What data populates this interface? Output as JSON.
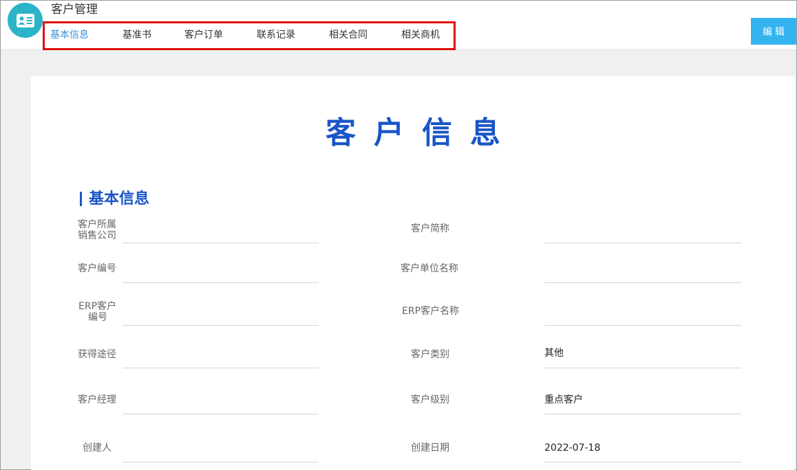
{
  "header": {
    "app_title": "客户管理",
    "logo_icon": "contact-card-icon",
    "tabs": [
      {
        "label": "基本信息",
        "active": true
      },
      {
        "label": "基准书",
        "active": false
      },
      {
        "label": "客户订单",
        "active": false
      },
      {
        "label": "联系记录",
        "active": false
      },
      {
        "label": "相关合同",
        "active": false
      },
      {
        "label": "相关商机",
        "active": false
      }
    ],
    "edit_label": "编辑"
  },
  "document": {
    "title": "客户信息",
    "section_title": "基本信息",
    "fields": {
      "sales_company": {
        "label_line1": "客户所属",
        "label_line2": "销售公司",
        "value": ""
      },
      "short_name": {
        "label": "客户简称",
        "value": ""
      },
      "customer_no": {
        "label": "客户编号",
        "value": ""
      },
      "unit_name": {
        "label": "客户单位名称",
        "value": ""
      },
      "erp_no": {
        "label_line1": "ERP客户",
        "label_line2": "编号",
        "value": ""
      },
      "erp_name": {
        "label": "ERP客户名称",
        "value": ""
      },
      "source": {
        "label": "获得途径",
        "value": ""
      },
      "category": {
        "label": "客户类别",
        "value": "其他"
      },
      "manager": {
        "label": "客户经理",
        "value": ""
      },
      "level": {
        "label": "客户级别",
        "value": "重点客户"
      },
      "creator": {
        "label": "创建人",
        "value": ""
      },
      "created_date": {
        "label": "创建日期",
        "value": "2022-07-18"
      }
    }
  },
  "colors": {
    "accent": "#1a56c8",
    "tab_active": "#3b8fd9",
    "button": "#33b4ef",
    "highlight_box": "#e00c0c",
    "logo": "#2bb3c8"
  }
}
